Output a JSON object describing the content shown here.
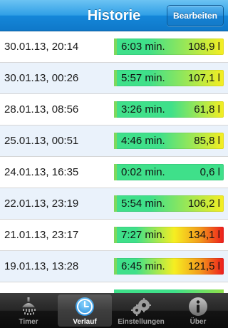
{
  "header": {
    "title": "Historie",
    "edit_button": "Bearbeiten"
  },
  "rows": [
    {
      "date": "30.01.13, 20:14",
      "duration": "6:03 min.",
      "volume": "108,9 l",
      "level": 0.81
    },
    {
      "date": "30.01.13, 00:26",
      "duration": "5:57 min.",
      "volume": "107,1 l",
      "level": 0.8
    },
    {
      "date": "28.01.13, 08:56",
      "duration": "3:26 min.",
      "volume": "61,8 l",
      "level": 0.46
    },
    {
      "date": "25.01.13, 00:51",
      "duration": "4:46 min.",
      "volume": "85,8 l",
      "level": 0.64
    },
    {
      "date": "24.01.13, 16:35",
      "duration": "0:02 min.",
      "volume": "0,6 l",
      "level": 0.0
    },
    {
      "date": "22.01.13, 23:19",
      "duration": "5:54 min.",
      "volume": "106,2 l",
      "level": 0.79
    },
    {
      "date": "21.01.13, 23:17",
      "duration": "7:27 min.",
      "volume": "134,1 l",
      "level": 1.0
    },
    {
      "date": "19.01.13, 13:28",
      "duration": "6:45 min.",
      "volume": "121,5 l",
      "level": 0.91
    }
  ],
  "colors": {
    "low": "#3fe08a",
    "high_end": "#ee1c1c",
    "yellow": "#f6ee21"
  },
  "tabs": [
    {
      "label": "Timer",
      "icon": "shower-icon",
      "active": false
    },
    {
      "label": "Verlauf",
      "icon": "clock-icon",
      "active": true
    },
    {
      "label": "Einstellungen",
      "icon": "gears-icon",
      "active": false
    },
    {
      "label": "Über",
      "icon": "info-icon",
      "active": false
    }
  ]
}
